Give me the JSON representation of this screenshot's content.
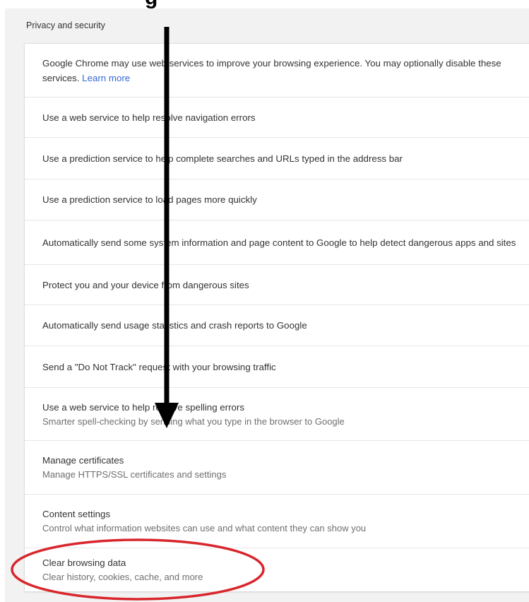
{
  "section": {
    "title": "Privacy and security"
  },
  "rows": [
    {
      "primary": "Google Chrome may use web services to improve your browsing experience. You may optionally disable these",
      "primary_cont": "services.",
      "link": "Learn more"
    },
    {
      "primary": "Use a web service to help resolve navigation errors"
    },
    {
      "primary": "Use a prediction service to help complete searches and URLs typed in the address bar"
    },
    {
      "primary": "Use a prediction service to load pages more quickly"
    },
    {
      "primary": "Automatically send some system information and page content to Google to help detect dangerous apps and sites"
    },
    {
      "primary": "Protect you and your device from dangerous sites"
    },
    {
      "primary": "Automatically send usage statistics and crash reports to Google"
    },
    {
      "primary": "Send a \"Do Not Track\" request with your browsing traffic"
    },
    {
      "primary": "Use a web service to help resolve spelling errors",
      "secondary": "Smarter spell-checking by sending what you type in the browser to Google"
    },
    {
      "primary": "Manage certificates",
      "secondary": "Manage HTTPS/SSL certificates and settings"
    },
    {
      "primary": "Content settings",
      "secondary": "Control what information websites can use and what content they can show you"
    },
    {
      "primary": "Clear browsing data",
      "secondary": "Clear history, cookies, cache, and more"
    }
  ],
  "annotations": {
    "arrow_color": "#000000",
    "circle_color": "#d8262c",
    "highlighted_item": "Clear browsing data"
  },
  "colors": {
    "link": "#3367d6",
    "primary_text": "#333333",
    "secondary_text": "#6f6f6f"
  }
}
